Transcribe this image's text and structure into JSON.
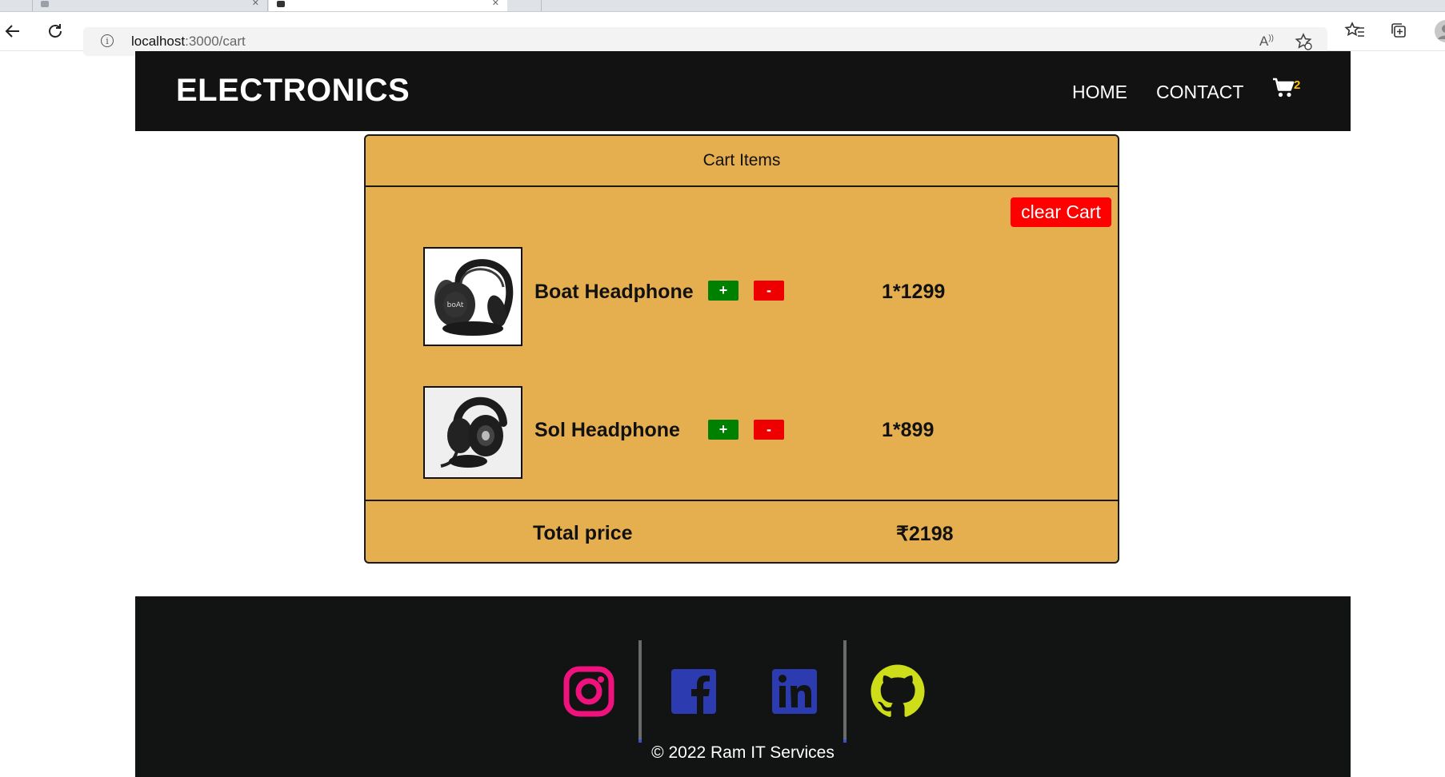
{
  "browser": {
    "url_host": "localhost",
    "url_path": ":3000/cart"
  },
  "header": {
    "brand": "ELECTRONICS",
    "nav": [
      "HOME",
      "CONTACT"
    ],
    "cart_count": "2"
  },
  "cart": {
    "title": "Cart Items",
    "clear_label": "clear Cart",
    "items": [
      {
        "name": "Boat Headphone",
        "plus": "+",
        "minus": "-",
        "price": "1*1299",
        "logo": "boAt"
      },
      {
        "name": "Sol Headphone",
        "plus": "+",
        "minus": "-",
        "price": "1*899"
      }
    ],
    "total_label": "Total price",
    "total_value": "₹2198"
  },
  "footer": {
    "copyright": "© 2022 Ram IT Services",
    "colors": {
      "instagram": "#f0127c",
      "facebook": "#2d3bb0",
      "linkedin": "#2d3bb0",
      "github": "#cddd1a"
    }
  },
  "colors": {
    "card_bg": "#e5af4f",
    "navbar_bg": "#121212",
    "clear_btn": "#ff0000",
    "plus_btn": "#008000",
    "minus_btn": "#ee0000",
    "cart_badge": "#ffc107"
  }
}
